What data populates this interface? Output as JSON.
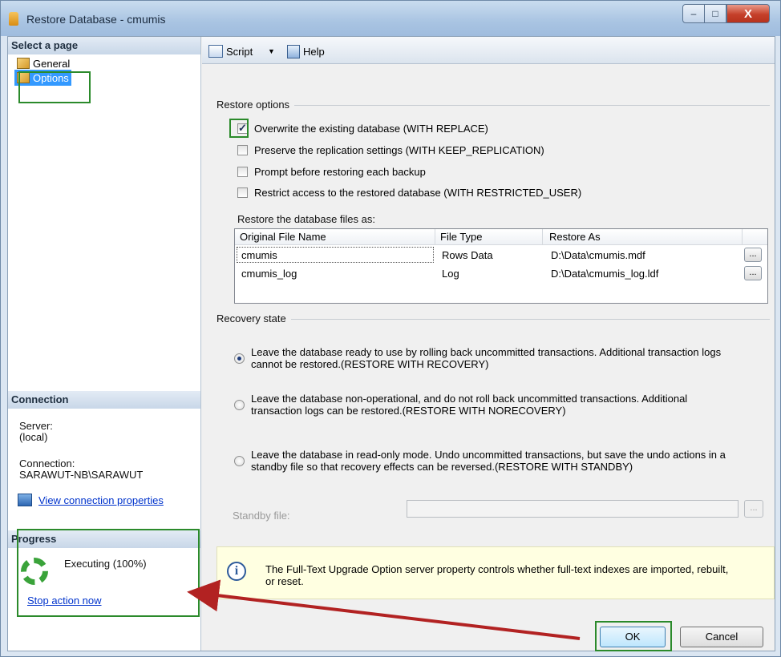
{
  "window": {
    "title": "Restore Database - cmumis",
    "minimize": "–",
    "maximize": "□",
    "close": "X"
  },
  "left": {
    "select_header": "Select a page",
    "pages": [
      {
        "label": "General"
      },
      {
        "label": "Options"
      }
    ],
    "connection_header": "Connection",
    "server_label": "Server:",
    "server_value": "(local)",
    "connection_label": "Connection:",
    "connection_value": "SARAWUT-NB\\SARAWUT",
    "view_link": "View connection properties",
    "progress_header": "Progress",
    "progress_status": "Executing (100%)",
    "stop_link": "Stop action now"
  },
  "toolbar": {
    "script": "Script",
    "help": "Help",
    "dropdown": "▼"
  },
  "restore_options": {
    "group": "Restore options",
    "checks": [
      {
        "label": "Overwrite the existing database (WITH REPLACE)",
        "checked": true
      },
      {
        "label": "Preserve the replication settings (WITH KEEP_REPLICATION)",
        "checked": false
      },
      {
        "label": "Prompt before restoring each backup",
        "checked": false
      },
      {
        "label": "Restrict access to the restored database (WITH RESTRICTED_USER)",
        "checked": false
      }
    ],
    "files_label": "Restore the database files as:",
    "columns": [
      "Original File Name",
      "File Type",
      "Restore As"
    ],
    "rows": [
      {
        "name": "cmumis",
        "type": "Rows Data",
        "restore_as": "D:\\Data\\cmumis.mdf",
        "btn": "..."
      },
      {
        "name": "cmumis_log",
        "type": "Log",
        "restore_as": "D:\\Data\\cmumis_log.ldf",
        "btn": "..."
      }
    ]
  },
  "recovery": {
    "group": "Recovery state",
    "options": [
      {
        "line1": "Leave the database ready to use by rolling back uncommitted transactions. Additional transaction logs",
        "line2": "cannot be restored.(RESTORE WITH RECOVERY)",
        "selected": true
      },
      {
        "line1": "Leave the database non-operational, and do not roll back uncommitted transactions. Additional",
        "line2": "transaction logs can be restored.(RESTORE WITH NORECOVERY)",
        "selected": false
      },
      {
        "line1": "Leave the database in read-only mode. Undo uncommitted transactions, but save the undo actions in a",
        "line2": "standby file so that recovery effects can be reversed.(RESTORE WITH STANDBY)",
        "selected": false
      }
    ],
    "standby_label": "Standby file:",
    "standby_value": "",
    "standby_btn": "..."
  },
  "info": {
    "icon": "i",
    "line1": "The Full-Text Upgrade Option server property controls whether full-text indexes are imported, rebuilt,",
    "line2": "or reset."
  },
  "buttons": {
    "ok": "OK",
    "cancel": "Cancel"
  },
  "colors": {
    "highlight": "#2b8a2b",
    "arrow": "#b22222",
    "selection": "#3399ff"
  }
}
